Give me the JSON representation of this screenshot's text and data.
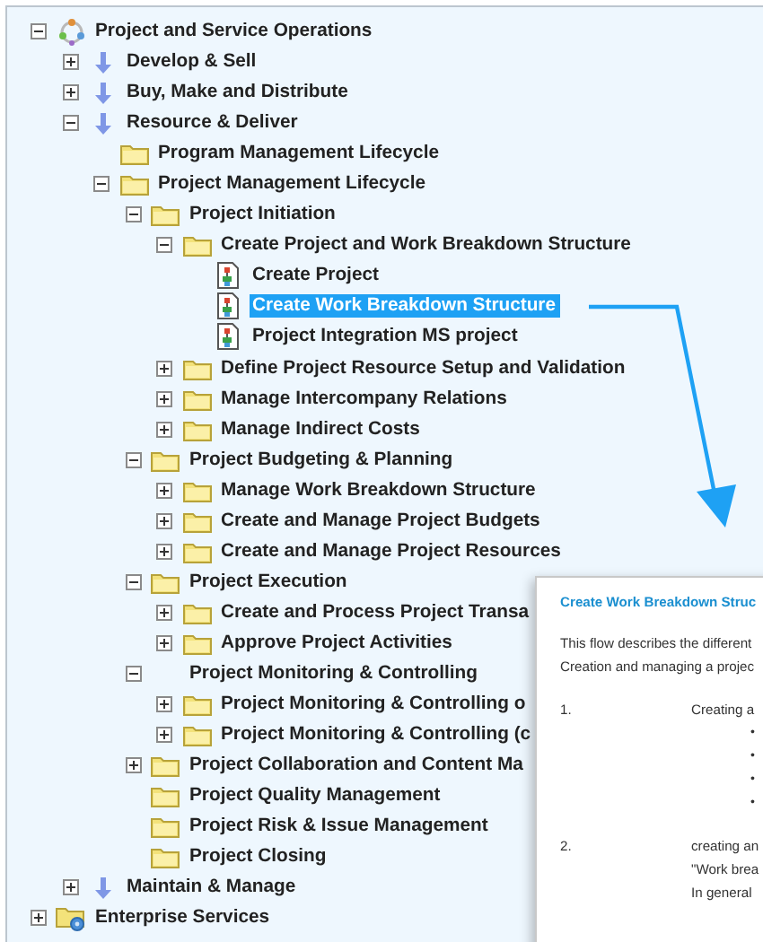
{
  "tree": [
    {
      "label": "Project and Service Operations",
      "kind": "process",
      "expanded": true,
      "selected": false,
      "children": [
        {
          "label": "Develop & Sell",
          "kind": "arrow",
          "expanded": false,
          "selected": false
        },
        {
          "label": "Buy, Make and Distribute",
          "kind": "arrow",
          "expanded": false,
          "selected": false
        },
        {
          "label": "Resource & Deliver",
          "kind": "arrow",
          "expanded": true,
          "selected": false,
          "children": [
            {
              "label": "Program Management Lifecycle",
              "kind": "folder",
              "selected": false
            },
            {
              "label": "Project Management Lifecycle",
              "kind": "folder",
              "expanded": true,
              "selected": false,
              "children": [
                {
                  "label": "Project Initiation",
                  "kind": "folder",
                  "expanded": true,
                  "selected": false,
                  "children": [
                    {
                      "label": "Create Project and Work Breakdown Structure",
                      "kind": "folder",
                      "expanded": true,
                      "selected": false,
                      "children": [
                        {
                          "label": "Create Project",
                          "kind": "document",
                          "selected": false
                        },
                        {
                          "label": "Create Work Breakdown Structure",
                          "kind": "document",
                          "selected": true
                        },
                        {
                          "label": "Project Integration MS project",
                          "kind": "document",
                          "selected": false
                        }
                      ]
                    },
                    {
                      "label": "Define Project Resource Setup and Validation",
                      "kind": "folder",
                      "expanded": false,
                      "selected": false
                    },
                    {
                      "label": "Manage Intercompany Relations",
                      "kind": "folder",
                      "expanded": false,
                      "selected": false
                    },
                    {
                      "label": "Manage Indirect Costs",
                      "kind": "folder",
                      "expanded": false,
                      "selected": false
                    }
                  ]
                },
                {
                  "label": "Project Budgeting & Planning",
                  "kind": "folder",
                  "expanded": true,
                  "selected": false,
                  "children": [
                    {
                      "label": "Manage Work Breakdown Structure",
                      "kind": "folder",
                      "expanded": false,
                      "selected": false
                    },
                    {
                      "label": "Create and Manage Project Budgets",
                      "kind": "folder",
                      "expanded": false,
                      "selected": false
                    },
                    {
                      "label": "Create and Manage Project Resources",
                      "kind": "folder",
                      "expanded": false,
                      "selected": false
                    }
                  ]
                },
                {
                  "label": "Project Execution",
                  "kind": "folder",
                  "expanded": true,
                  "selected": false,
                  "children": [
                    {
                      "label": "Create and Process Project Transa",
                      "kind": "folder",
                      "expanded": false,
                      "selected": false
                    },
                    {
                      "label": "Approve Project Activities",
                      "kind": "folder",
                      "expanded": false,
                      "selected": false
                    }
                  ]
                },
                {
                  "label": "Project Monitoring & Controlling",
                  "kind": "none",
                  "expanded": true,
                  "selected": false,
                  "children": [
                    {
                      "label": "Project Monitoring & Controlling o",
                      "kind": "folder",
                      "expanded": false,
                      "selected": false
                    },
                    {
                      "label": "Project Monitoring & Controlling (c",
                      "kind": "folder",
                      "expanded": false,
                      "selected": false
                    }
                  ]
                },
                {
                  "label": "Project Collaboration and Content Ma",
                  "kind": "folder",
                  "expanded": false,
                  "selected": false
                },
                {
                  "label": "Project Quality Management",
                  "kind": "folder",
                  "selected": false
                },
                {
                  "label": "Project Risk & Issue Management",
                  "kind": "folder",
                  "selected": false
                },
                {
                  "label": "Project Closing",
                  "kind": "folder",
                  "selected": false
                }
              ]
            }
          ]
        },
        {
          "label": "Maintain & Manage",
          "kind": "arrow",
          "expanded": false,
          "selected": false
        }
      ]
    },
    {
      "label": "Enterprise Services",
      "kind": "folder-gear",
      "expanded": false,
      "selected": false
    }
  ],
  "popup": {
    "title": "Create Work Breakdown Struc",
    "intro": [
      "This flow describes the different",
      "Creation and managing a projec"
    ],
    "steps": [
      {
        "number": "1.",
        "lines": [
          "Creating a"
        ],
        "bullets": [
          "•",
          "•",
          "•",
          "•"
        ]
      },
      {
        "number": "2.",
        "lines": [
          "creating an",
          "\"Work brea",
          "In general"
        ]
      }
    ]
  }
}
